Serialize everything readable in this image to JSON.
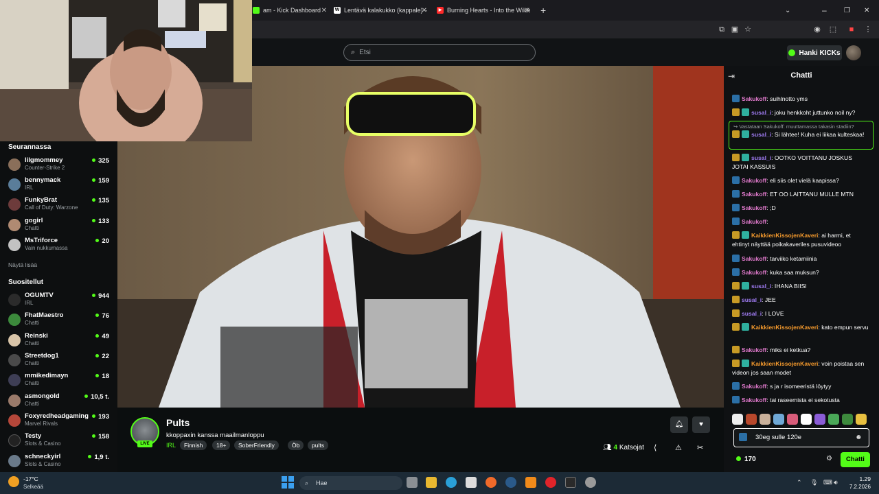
{
  "browser": {
    "tabs": [
      {
        "label": "am - Kick Dashboard",
        "fav_color": "#53fc18",
        "fav_glyph": ""
      },
      {
        "label": "Lentävä kalakukko (kappale) – W",
        "fav_color": "#ffffff",
        "fav_glyph": "W"
      },
      {
        "label": "Burning Hearts - Into the Wilde",
        "fav_color": "#ff2a2a",
        "fav_glyph": "▶"
      }
    ],
    "new_tab": "+"
  },
  "header": {
    "search_placeholder": "Etsi",
    "kicks_button": "Hanki KICKs"
  },
  "sidebar": {
    "following_heading": "Seurannassa",
    "following": [
      {
        "name": "lilgmommey",
        "category": "Counter-Strike 2",
        "viewers": "325",
        "color": "#8a6f5a"
      },
      {
        "name": "bennymack",
        "category": "IRL",
        "viewers": "159",
        "color": "#5a7d9a"
      },
      {
        "name": "FunkyBrat",
        "category": "Call of Duty: Warzone",
        "viewers": "135",
        "color": "#6d3b3b"
      },
      {
        "name": "gogirl",
        "category": "Chatti",
        "viewers": "133",
        "color": "#b08a72"
      },
      {
        "name": "MsTriforce",
        "category": "Vain nukkumassa",
        "viewers": "20",
        "color": "#c2c2c2"
      }
    ],
    "following_more": "Näytä lisää",
    "recommended_heading": "Suositellut",
    "recommended": [
      {
        "name": "OGUMTV",
        "category": "IRL",
        "viewers": "944",
        "color": "#2b2b2b"
      },
      {
        "name": "FhatMaestro",
        "category": "Chatti",
        "viewers": "76",
        "color": "#3c8a3c"
      },
      {
        "name": "Reinski",
        "category": "Chatti",
        "viewers": "49",
        "color": "#d8c4a8"
      },
      {
        "name": "Streetdog1",
        "category": "Chatti",
        "viewers": "22",
        "color": "#4a4a4a"
      },
      {
        "name": "mmikedimayn",
        "category": "Chatti",
        "viewers": "18",
        "color": "#3e3e55"
      },
      {
        "name": "asmongold",
        "category": "Chatti",
        "viewers": "10,5 t.",
        "color": "#9a7a6a"
      },
      {
        "name": "Foxyredheadgaming",
        "category": "Marvel Rivals",
        "viewers": "193",
        "color": "#b5473a"
      },
      {
        "name": "Testy",
        "category": "Slots & Casino",
        "viewers": "158",
        "color": "#222222"
      },
      {
        "name": "schneckyirl",
        "category": "Slots & Casino",
        "viewers": "1,9 t.",
        "color": "#6a7a8a"
      }
    ]
  },
  "stream": {
    "channel": "Pults",
    "live": "LIVE",
    "title": "kkoppaxin kanssa maailmanloppu",
    "category": "IRL",
    "tags": [
      "Finnish",
      "18+",
      "SoberFriendly",
      "Öb",
      "pults"
    ],
    "viewers_count": "4",
    "viewers_label": "Katsojat"
  },
  "chat": {
    "title": "Chatti",
    "reply_label": "↪ Vastataan Sakukoff: muuttamassa takasin stadiin?",
    "messages": [
      {
        "user": "Sakukoff",
        "cls": "user-saku",
        "badges": [
          "kick"
        ],
        "text": ": suihlnotto yms"
      },
      {
        "user": "susal_i",
        "cls": "user-susal",
        "badges": [
          "sub",
          "gift"
        ],
        "text": ": joku henkkoht juttunko noil ny?"
      },
      {
        "user": "susal_i",
        "cls": "user-susal",
        "badges": [
          "sub",
          "gift"
        ],
        "text": ": Si lähtee! Kuha ei liikaa kulteskaa!"
      },
      {
        "user": "susal_i",
        "cls": "user-susal",
        "badges": [
          "sub",
          "gift"
        ],
        "text": ": OOTKO VOITTANU JOSKUS JOTAI KASSUIS"
      },
      {
        "user": "Sakukoff",
        "cls": "user-saku",
        "badges": [
          "kick"
        ],
        "text": ": eli siis olet vielä kaapissa?"
      },
      {
        "user": "Sakukoff",
        "cls": "user-saku",
        "badges": [
          "kick"
        ],
        "text": ": ET OO LAITTANU MULLE MTN"
      },
      {
        "user": "Sakukoff",
        "cls": "user-saku",
        "badges": [
          "kick"
        ],
        "text": ": ;D"
      },
      {
        "user": "Sakukoff",
        "cls": "user-saku",
        "badges": [
          "kick"
        ],
        "text": ": "
      },
      {
        "user": "KaikkienKissojenKaveri",
        "cls": "user-kaikki",
        "badges": [
          "sub",
          "gift"
        ],
        "text": ": ai harmi, et ehtinyt näyttää poikakaveriles pusuvideoo"
      },
      {
        "user": "Sakukoff",
        "cls": "user-saku",
        "badges": [
          "kick"
        ],
        "text": ": tarviiko ketamiinia"
      },
      {
        "user": "Sakukoff",
        "cls": "user-saku",
        "badges": [
          "kick"
        ],
        "text": ": kuka saa muksun?"
      },
      {
        "user": "susal_i",
        "cls": "user-susal",
        "badges": [
          "sub",
          "gift"
        ],
        "text": ": IHANA BIISI"
      },
      {
        "user": "susal_i",
        "cls": "user-susal",
        "badges": [
          "sub"
        ],
        "text": ": JEE"
      },
      {
        "user": "susal_i",
        "cls": "user-susal",
        "badges": [
          "sub"
        ],
        "text": ": I LOVE"
      },
      {
        "user": "KaikkienKissojenKaveri",
        "cls": "user-kaikki",
        "badges": [
          "sub",
          "gift"
        ],
        "text": ": kato empun servu"
      },
      {
        "user": "Sakukoff",
        "cls": "user-saku",
        "badges": [
          "sub"
        ],
        "text": ": miks ei ketkua?"
      },
      {
        "user": "KaikkienKissojenKaveri",
        "cls": "user-kaikki",
        "badges": [
          "sub",
          "gift"
        ],
        "text": ": voin poistaa sen videon jos saan modet"
      },
      {
        "user": "Sakukoff",
        "cls": "user-saku",
        "badges": [
          "kick"
        ],
        "text": ": s ja r isomeeristä löytyy"
      },
      {
        "user": "Sakukoff",
        "cls": "user-saku",
        "badges": [
          "kick"
        ],
        "text": ": tai raseemista ei sekotusta"
      }
    ],
    "input_value": "30eg sulle 120e",
    "kicks": "170",
    "send": "Chatti"
  },
  "taskbar": {
    "temp": "-17°C",
    "weather": "Selkeää",
    "search": "Hae",
    "time": "1.29",
    "date": "7.2.2026"
  }
}
